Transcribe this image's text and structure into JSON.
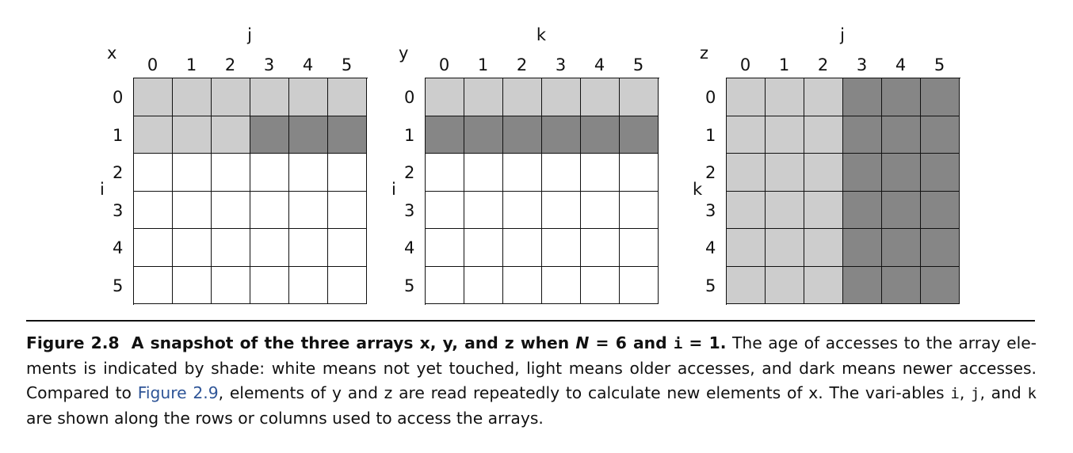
{
  "diagram": {
    "arrays": [
      {
        "name": "x",
        "row_var": "i",
        "col_var": "j",
        "row_labels": [
          "0",
          "1",
          "2",
          "3",
          "4",
          "5"
        ],
        "col_labels": [
          "0",
          "1",
          "2",
          "3",
          "4",
          "5"
        ],
        "cells": [
          [
            "light",
            "light",
            "light",
            "light",
            "light",
            "light"
          ],
          [
            "light",
            "light",
            "light",
            "dark",
            "dark",
            "dark"
          ],
          [
            "white",
            "white",
            "white",
            "white",
            "white",
            "white"
          ],
          [
            "white",
            "white",
            "white",
            "white",
            "white",
            "white"
          ],
          [
            "white",
            "white",
            "white",
            "white",
            "white",
            "white"
          ],
          [
            "white",
            "white",
            "white",
            "white",
            "white",
            "white"
          ]
        ]
      },
      {
        "name": "y",
        "row_var": "i",
        "col_var": "k",
        "row_labels": [
          "0",
          "1",
          "2",
          "3",
          "4",
          "5"
        ],
        "col_labels": [
          "0",
          "1",
          "2",
          "3",
          "4",
          "5"
        ],
        "cells": [
          [
            "light",
            "light",
            "light",
            "light",
            "light",
            "light"
          ],
          [
            "dark",
            "dark",
            "dark",
            "dark",
            "dark",
            "dark"
          ],
          [
            "white",
            "white",
            "white",
            "white",
            "white",
            "white"
          ],
          [
            "white",
            "white",
            "white",
            "white",
            "white",
            "white"
          ],
          [
            "white",
            "white",
            "white",
            "white",
            "white",
            "white"
          ],
          [
            "white",
            "white",
            "white",
            "white",
            "white",
            "white"
          ]
        ]
      },
      {
        "name": "z",
        "row_var": "k",
        "col_var": "j",
        "row_labels": [
          "0",
          "1",
          "2",
          "3",
          "4",
          "5"
        ],
        "col_labels": [
          "0",
          "1",
          "2",
          "3",
          "4",
          "5"
        ],
        "cells": [
          [
            "light",
            "light",
            "light",
            "dark",
            "dark",
            "dark"
          ],
          [
            "light",
            "light",
            "light",
            "dark",
            "dark",
            "dark"
          ],
          [
            "light",
            "light",
            "light",
            "dark",
            "dark",
            "dark"
          ],
          [
            "light",
            "light",
            "light",
            "dark",
            "dark",
            "dark"
          ],
          [
            "light",
            "light",
            "light",
            "dark",
            "dark",
            "dark"
          ],
          [
            "light",
            "light",
            "light",
            "dark",
            "dark",
            "dark"
          ]
        ]
      }
    ],
    "shade_colors": {
      "white": "#ffffff",
      "light": "#cdcdcd",
      "dark": "#868686"
    }
  },
  "caption": {
    "label": "Figure 2.8",
    "title_a": "A snapshot of the three arrays x, y, and z when ",
    "title_n": "N",
    "title_b": " = 6 and ",
    "title_i": "i",
    "title_c": " = 1.",
    "body_1": " The age of accesses to the array ele-ments is indicated by shade: white means not yet touched, light means older accesses, and dark means newer accesses. Compared to ",
    "link": "Figure 2.9",
    "body_2": ", elements of y and z are read repeatedly to calculate new elements of x. The vari-ables ",
    "var_i": "i",
    "sep_1": ", ",
    "var_j": "j",
    "sep_2": ", and ",
    "var_k": "k",
    "body_3": " are shown along the rows or columns used to access the arrays."
  }
}
